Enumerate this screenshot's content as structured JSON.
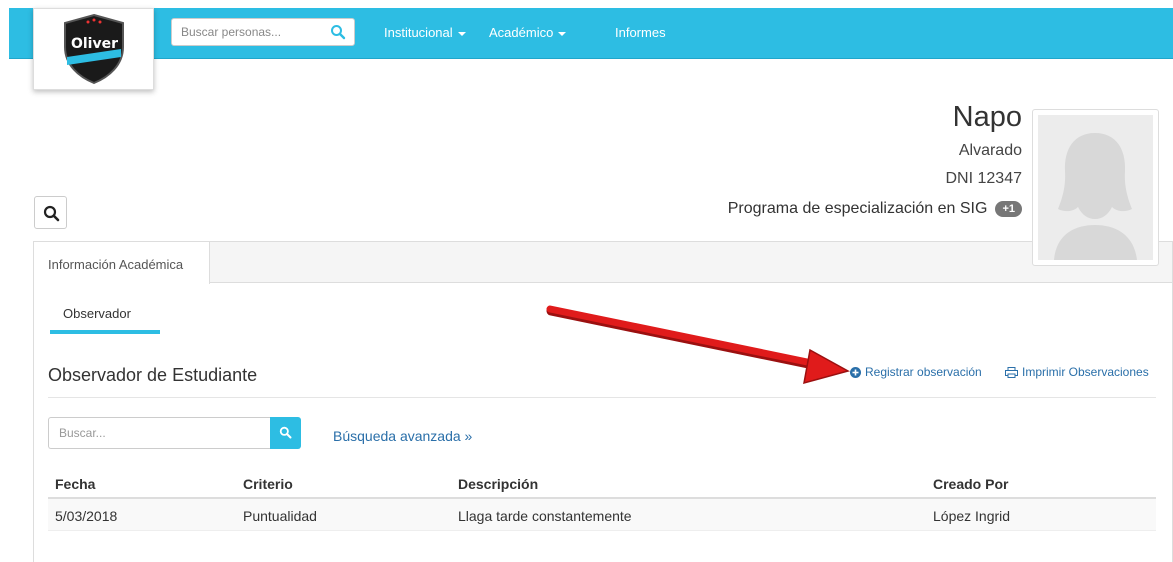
{
  "navbar": {
    "logo": {
      "text": "Oliver"
    },
    "search": {
      "placeholder": "Buscar personas..."
    },
    "items": [
      {
        "label": "Institucional"
      },
      {
        "label": "Académico"
      },
      {
        "label": "Informes"
      }
    ]
  },
  "profile": {
    "first_name": "Napo",
    "last_name": "Alvarado",
    "dni": "DNI 12347",
    "program": "Programa de especialización en SIG",
    "program_badge": "+1"
  },
  "tabs": [
    {
      "label": "Información Académica"
    }
  ],
  "subtabs": [
    {
      "label": "Observador"
    }
  ],
  "section": {
    "title": "Observador de Estudiante",
    "actions": [
      {
        "label": "Registrar observación",
        "icon": "plus-circle-icon"
      },
      {
        "label": "Imprimir Observaciones",
        "icon": "print-icon"
      }
    ]
  },
  "filter": {
    "placeholder": "Buscar...",
    "advanced_label": "Búsqueda avanzada »"
  },
  "table": {
    "columns": [
      "Fecha",
      "Criterio",
      "Descripción",
      "Creado Por"
    ],
    "rows": [
      [
        "5/03/2018",
        "Puntualidad",
        "Llaga tarde constantemente",
        "López Ingrid"
      ]
    ]
  },
  "colors": {
    "navbar": "#2dbde3",
    "link": "#2a6fa9",
    "annotation_arrow": "#e01b1b"
  }
}
